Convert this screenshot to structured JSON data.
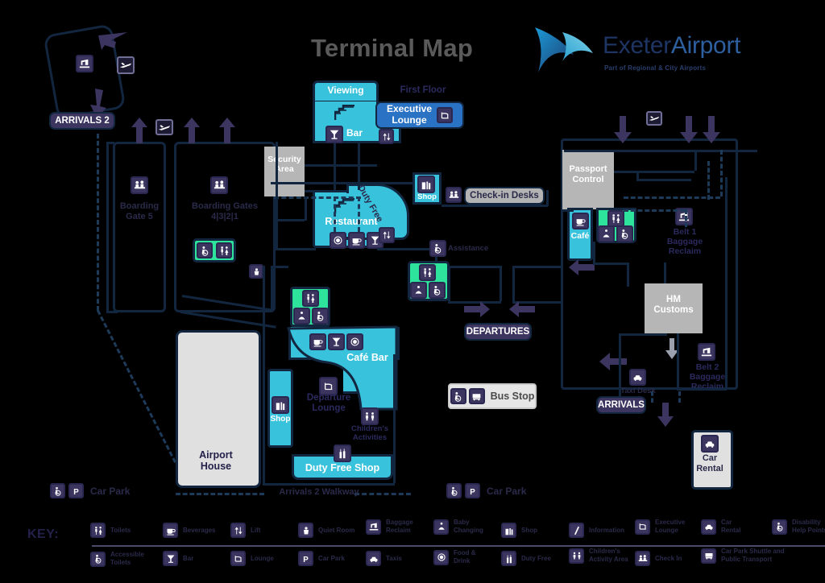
{
  "page": {
    "title": "Terminal Map",
    "logo_main_a": "Exeter",
    "logo_main_b": "Airport",
    "logo_sub": "Part of Regional & City Airports"
  },
  "colors": {
    "background": "#000000",
    "wall": "#13263f",
    "cyan": "#39c2dc",
    "green": "#2ee39c",
    "grey": "#b6b6b6",
    "light_grey": "#e0e0e0",
    "purple": "#3b3560",
    "blue": "#2a72c4",
    "title_grey": "#5a5a5a",
    "label_dark": "#2b2a4a",
    "logo_navy": "#1e3564"
  },
  "map": {
    "arrivals2_label": "ARRIVALS 2",
    "departures_label": "DEPARTURES",
    "arrivals_label": "ARRIVALS",
    "first_floor_label": "First Floor",
    "zones": {
      "viewing": "Viewing",
      "bar": "Bar",
      "executive_lounge": "Executive Lounge",
      "security_area": "Security Area",
      "restaurant": "Restaurant",
      "shop_upper": "Shop",
      "checkin_desks": "Check-in Desks",
      "passport_control": "Passport Control",
      "cafe": "Café",
      "belt1": "Belt 1 Baggage Reclaim",
      "hm_customs": "HM Customs",
      "belt2": "Belt 2 Baggage Reclaim",
      "taxi_desk": "Taxi Desk",
      "car_rental": "Car Rental",
      "boarding_gate5": "Boarding Gate 5",
      "boarding_gates_4321": "Boarding Gates 4|3|2|1",
      "cafe_bar": "Café Bar",
      "departure_lounge": "Departure Lounge",
      "childrens_activities": "Children's Activities",
      "duty_free_shop": "Duty Free Shop",
      "shop_lower": "Shop",
      "airport_house": "Airport House",
      "duty_free_diagonal": "Duty Free",
      "assistance": "Assistance",
      "bus_stop": "Bus Stop",
      "car_park_left": "Car Park",
      "car_park_right": "Car Park",
      "arrivals2_walkway": "Arrivals 2 Walkway"
    },
    "zone_split_labels": {
      "boarding_gate5_l1": "Boarding",
      "boarding_gate5_l2": "Gate 5",
      "boarding_gates_l1": "Boarding Gates",
      "boarding_gates_l2": "4|3|2|1",
      "security_l1": "Security",
      "security_l2": "Area",
      "passport_l1": "Passport",
      "passport_l2": "Control",
      "belt1_l1": "Belt 1",
      "belt1_l2": "Baggage",
      "belt1_l3": "Reclaim",
      "customs_l1": "HM",
      "customs_l2": "Customs",
      "belt2_l1": "Belt 2",
      "belt2_l2": "Baggage",
      "belt2_l3": "Reclaim",
      "car_rental_l1": "Car",
      "car_rental_l2": "Rental",
      "dep_lounge_l1": "Departure",
      "dep_lounge_l2": "Lounge",
      "child_l1": "Children's",
      "child_l2": "Activities",
      "airport_house_l1": "Airport",
      "airport_house_l2": "House",
      "exec_l1": "Executive",
      "exec_l2": "Lounge"
    }
  },
  "key": {
    "title": "KEY:",
    "columns": [
      {
        "top": {
          "icon": "toilets-icon",
          "label": "Toilets"
        },
        "bottom": {
          "icon": "accessible-toilets-icon",
          "label": "Accessible Toilets"
        }
      },
      {
        "top": {
          "icon": "beverages-icon",
          "label": "Beverages"
        },
        "bottom": {
          "icon": "bar-icon",
          "label": "Bar"
        }
      },
      {
        "top": {
          "icon": "lift-icon",
          "label": "Lift"
        },
        "bottom": {
          "icon": "lounge-icon",
          "label": "Lounge"
        }
      },
      {
        "top": {
          "icon": "quiet-room-icon",
          "label": "Quiet Room"
        },
        "bottom": {
          "icon": "car-park-icon",
          "label": "Car Park"
        }
      },
      {
        "top": {
          "icon": "baggage-reclaim-icon",
          "label": "Baggage Reclaim"
        },
        "bottom": {
          "icon": "taxis-icon",
          "label": "Taxis"
        }
      },
      {
        "top": {
          "icon": "baby-changing-icon",
          "label": "Baby Changing"
        },
        "bottom": {
          "icon": "food-drink-icon",
          "label": "Food & Drink"
        }
      },
      {
        "top": {
          "icon": "shop-icon",
          "label": "Shop"
        },
        "bottom": {
          "icon": "duty-free-icon",
          "label": "Duty Free"
        }
      },
      {
        "top": {
          "icon": "information-icon",
          "label": "Information"
        },
        "bottom": {
          "icon": "childrens-activity-icon",
          "label": "Children's Activity Area"
        }
      },
      {
        "top": {
          "icon": "executive-lounge-icon",
          "label": "Executive Lounge"
        },
        "bottom": {
          "icon": "check-in-icon",
          "label": "Check In"
        }
      },
      {
        "top": {
          "icon": "car-rental-icon",
          "label": "Car Rental"
        },
        "bottom": {
          "icon": "shuttle-icon",
          "label": "Car Park Shuttle and Public Transport"
        }
      },
      {
        "top": {
          "icon": "disability-help-icon",
          "label": "Disability Help Points"
        },
        "bottom": {
          "icon": "",
          "label": ""
        }
      }
    ]
  }
}
